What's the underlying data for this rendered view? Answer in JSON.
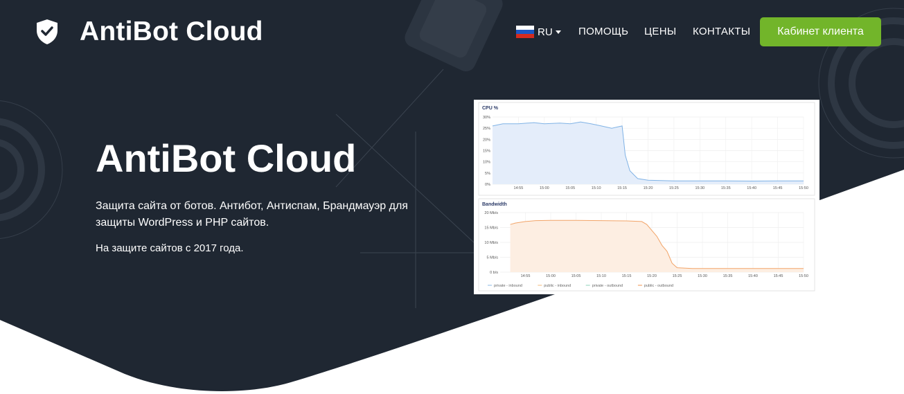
{
  "brand": {
    "name": "AntiBot Cloud",
    "icon": "shield-check-icon"
  },
  "nav": {
    "language": {
      "code": "RU",
      "flag": "russia-flag-icon"
    },
    "links": [
      "ПОМОЩЬ",
      "ЦЕНЫ",
      "КОНТАКТЫ"
    ],
    "cta": "Кабинет клиента"
  },
  "hero": {
    "title": "AntiBot Cloud",
    "description": "Защита сайта от ботов. Антибот, Антиспам, Брандмауэр для защиты WordPress и PHP сайтов.",
    "since": "На защите сайтов с 2017 года."
  },
  "colors": {
    "background": "#1f2732",
    "accent": "#72b52a",
    "cpu_line": "#7fb2e5",
    "bandwidth_line": "#f2a468"
  },
  "chart_data": [
    {
      "type": "area",
      "title": "CPU %",
      "x": [
        "14:55",
        "15:00",
        "15:05",
        "15:10",
        "15:15",
        "15:20",
        "15:25",
        "15:30",
        "15:35",
        "15:40",
        "15:45",
        "15:50"
      ],
      "y_ticks": [
        "0%",
        "5%",
        "10%",
        "15%",
        "20%",
        "25%",
        "30%"
      ],
      "ylim": [
        0,
        30
      ],
      "xlim": [
        "14:50",
        "15:50"
      ],
      "series": [
        {
          "values": [
            [
              0,
              26
            ],
            [
              2,
              27
            ],
            [
              5,
              27
            ],
            [
              8,
              27.5
            ],
            [
              10,
              27
            ],
            [
              13,
              27.3
            ],
            [
              15,
              27
            ],
            [
              17,
              27.8
            ],
            [
              19,
              27
            ],
            [
              21,
              26
            ],
            [
              23,
              25
            ],
            [
              24,
              25.5
            ],
            [
              25,
              26
            ],
            [
              25.6,
              13
            ],
            [
              26.5,
              6
            ],
            [
              28,
              2.5
            ],
            [
              30,
              1.8
            ],
            [
              35,
              1.5
            ],
            [
              40,
              1.5
            ],
            [
              45,
              1.5
            ],
            [
              50,
              1.4
            ],
            [
              55,
              1.5
            ],
            [
              60,
              1.5
            ]
          ]
        }
      ]
    },
    {
      "type": "area",
      "title": "Bandwidth",
      "x": [
        "14:55",
        "15:00",
        "15:05",
        "15:10",
        "15:15",
        "15:20",
        "15:25",
        "15:30",
        "15:35",
        "15:40",
        "15:45",
        "15:50"
      ],
      "y_ticks": [
        "0 b/s",
        "5 Mb/s",
        "10 Mb/s",
        "15 Mb/s",
        "20 Mb/s"
      ],
      "ylim": [
        0,
        20
      ],
      "xlim": [
        "14:50",
        "15:50"
      ],
      "series": [
        {
          "name": "private - inbound",
          "values": []
        },
        {
          "name": "public - inbound",
          "values": []
        },
        {
          "name": "private - outbound",
          "values": []
        },
        {
          "name": "public - outbound",
          "values": [
            [
              2,
              16
            ],
            [
              3,
              16.5
            ],
            [
              5,
              17
            ],
            [
              7,
              17.3
            ],
            [
              10,
              17.4
            ],
            [
              15,
              17.4
            ],
            [
              20,
              17.3
            ],
            [
              25,
              17.2
            ],
            [
              28,
              17
            ],
            [
              29,
              16
            ],
            [
              30,
              14
            ],
            [
              31,
              12
            ],
            [
              32,
              9
            ],
            [
              33,
              7
            ],
            [
              33.5,
              5
            ],
            [
              34,
              3
            ],
            [
              35,
              1.5
            ],
            [
              38,
              1.2
            ],
            [
              45,
              1.2
            ],
            [
              52,
              1.2
            ],
            [
              58,
              1.2
            ],
            [
              60,
              1.2
            ]
          ]
        }
      ]
    }
  ]
}
